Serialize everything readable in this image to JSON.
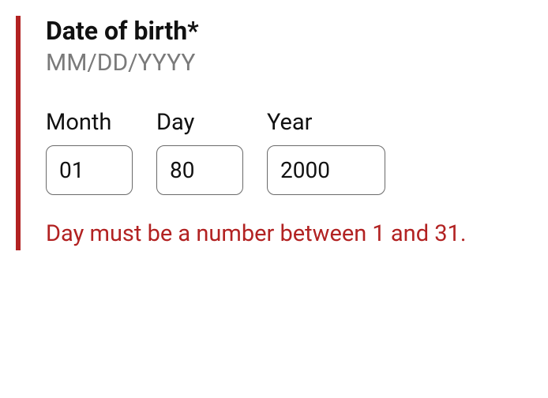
{
  "dob": {
    "legend": "Date of birth*",
    "hint": "MM/DD/YYYY",
    "fields": {
      "month": {
        "label": "Month",
        "value": "01"
      },
      "day": {
        "label": "Day",
        "value": "80"
      },
      "year": {
        "label": "Year",
        "value": "2000"
      }
    },
    "error": "Day must be a number between 1 and 31."
  },
  "colors": {
    "error_border": "#b22222"
  }
}
